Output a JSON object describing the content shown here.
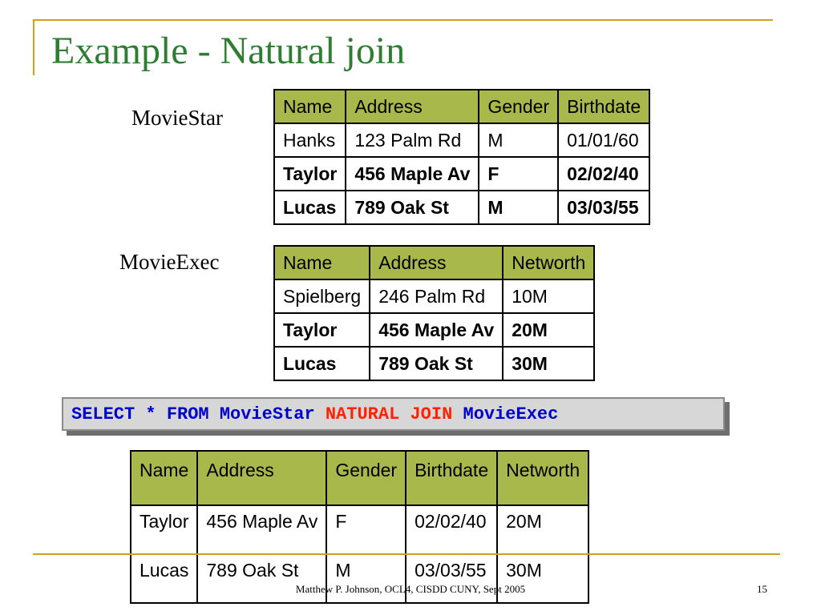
{
  "title": "Example - Natural join",
  "movie_star": {
    "label": "MovieStar",
    "headers": [
      "Name",
      "Address",
      "Gender",
      "Birthdate"
    ],
    "rows": [
      [
        "Hanks",
        "123 Palm Rd",
        "M",
        "01/01/60"
      ],
      [
        "Taylor",
        "456 Maple Av",
        "F",
        "02/02/40"
      ],
      [
        "Lucas",
        "789 Oak St",
        "M",
        "03/03/55"
      ]
    ]
  },
  "movie_exec": {
    "label": "MovieExec",
    "headers": [
      "Name",
      "Address",
      "Networth"
    ],
    "rows": [
      [
        "Spielberg",
        "246 Palm Rd",
        "10M"
      ],
      [
        "Taylor",
        "456 Maple Av",
        "20M"
      ],
      [
        "Lucas",
        "789 Oak St",
        "30M"
      ]
    ]
  },
  "sql": {
    "select": "SELECT * FROM MovieStar ",
    "natural_join": "NATURAL JOIN ",
    "table": "MovieExec"
  },
  "result": {
    "headers": [
      "Name",
      "Address",
      "Gender",
      "Birthdate",
      "Networth"
    ],
    "rows": [
      [
        "Taylor",
        "456 Maple Av",
        "F",
        "02/02/40",
        "20M"
      ],
      [
        "Lucas",
        "789 Oak St",
        "M",
        "03/03/55",
        "30M"
      ]
    ]
  },
  "footer": {
    "text": "Matthew P. Johnson, OCL4, CISDD CUNY, Sept 2005",
    "page": "15"
  },
  "colors": {
    "title": "#2e7d32",
    "header_fill": "#a8b84a",
    "accent_line": "#d0a020",
    "sql_keyword": "#0000cc",
    "sql_natural_join": "#ff2200"
  }
}
